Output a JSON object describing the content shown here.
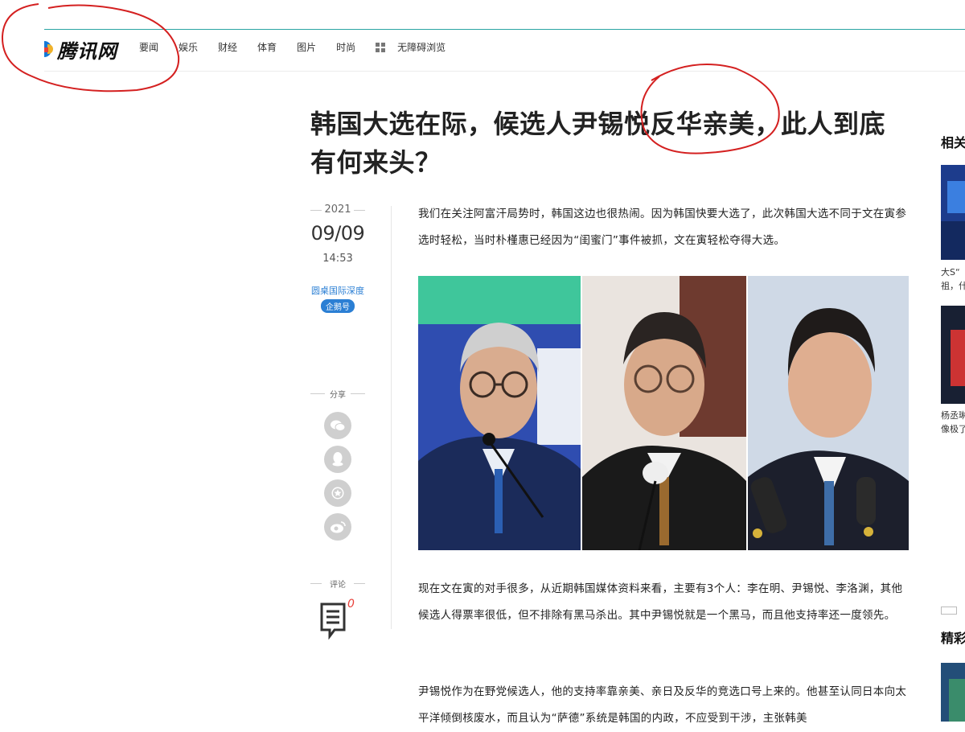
{
  "header": {
    "logo_text": "腾讯网",
    "nav": [
      "要闻",
      "娱乐",
      "财经",
      "体育",
      "图片",
      "时尚"
    ],
    "accessibility": "无障碍浏览",
    "brand_colors": {
      "blue": "#1479d7",
      "yellow": "#f0b22a",
      "red": "#e8403a",
      "teal_line": "#2aa5a3"
    }
  },
  "article": {
    "title": "韩国大选在际，候选人尹锡悦反华亲美，此人到底有何来头？",
    "date_year": "2021",
    "date_day": "09/09",
    "date_time": "14:53",
    "source": "圆桌国际深度",
    "source_badge": "企鹅号",
    "paragraphs": [
      "我们在关注阿富汗局势时，韩国这边也很热闹。因为韩国快要大选了，此次韩国大选不同于文在寅参选时轻松，当时朴槿惠已经因为“闺蜜门”事件被抓，文在寅轻松夺得大选。",
      "现在文在寅的对手很多，从近期韩国媒体资料来看，主要有3个人：李在明、尹锡悦、李洛渊，其他候选人得票率很低，但不排除有黑马杀出。其中尹锡悦就是一个黑马，而且他支持率还一度领先。",
      "尹锡悦作为在野党候选人，他的支持率靠亲美、亲日及反华的竞选口号上来的。他甚至认同日本向太平洋倾倒核废水，而且认为“萨德”系统是韩国的内政，不应受到干涉，主张韩美"
    ],
    "image_icon": "three-candidates-photo"
  },
  "share": {
    "label": "分享",
    "buttons": [
      "wechat-icon",
      "qq-icon",
      "favorite-icon",
      "weibo-icon"
    ]
  },
  "comment": {
    "label": "评论",
    "badge": "0"
  },
  "right_column": {
    "heading1": "相关",
    "caption1_line1": "大S“",
    "caption1_line2": "祖，什",
    "caption2_line1": "杨丞琳",
    "caption2_line2": "像极了",
    "heading2": "精彩"
  },
  "annotations_color": "#d42020"
}
